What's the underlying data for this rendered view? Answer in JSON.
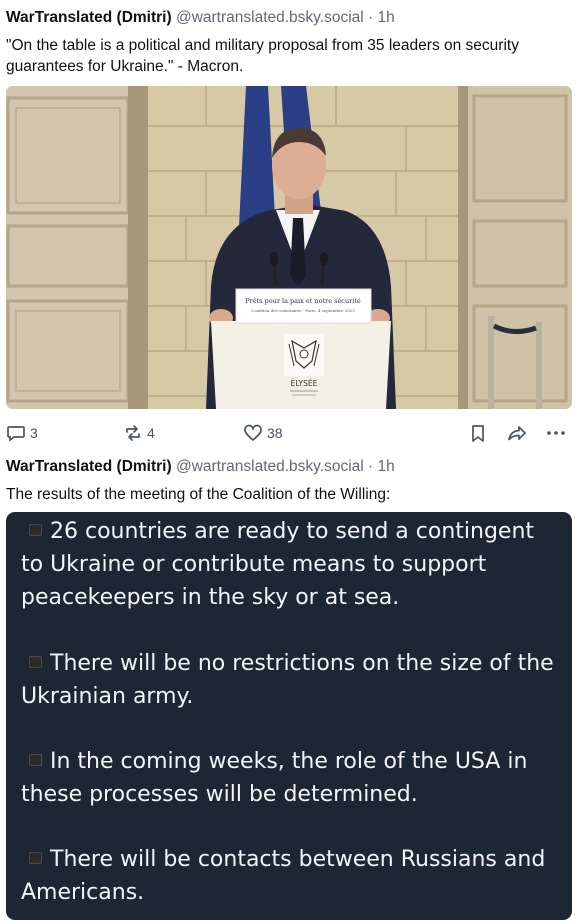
{
  "posts": [
    {
      "author": "WarTranslated (Dmitri)",
      "handle": "@wartranslated.bsky.social",
      "time": "· 1h",
      "text": "\"On the table is a political and military proposal from 35 leaders on security guarantees for Ukraine.\" - Macron.",
      "image": {
        "lectern_title": "Prêts pour la paix et notre sécurité",
        "lectern_subtitle": "Coalition des volontaires · Paris, 4 septembre 2025",
        "emblem_label": "ÉLYSÉE"
      },
      "actions": {
        "replies": "3",
        "reposts": "4",
        "likes": "38",
        "icons": [
          "reply-icon",
          "repost-icon",
          "like-icon",
          "bookmark-icon",
          "share-icon",
          "more-icon"
        ]
      }
    },
    {
      "author": "WarTranslated (Dmitri)",
      "handle": "@wartranslated.bsky.social",
      "time": "· 1h",
      "text": "The results of the meeting of the Coalition of the Willing:",
      "image_bullets": [
        "26 countries are ready to send a contingent to Ukraine or contribute means to support peacekeepers in the sky or at sea.",
        "There will be no restrictions on the size of the Ukrainian army.",
        "In the coming weeks, the role of the USA in these processes will be determined.",
        "There will be contacts between Russians and Americans."
      ]
    }
  ],
  "colors": {
    "text": "#111111",
    "muted": "#667788",
    "action": "#4a5563",
    "card_bg": "#1c2733"
  }
}
